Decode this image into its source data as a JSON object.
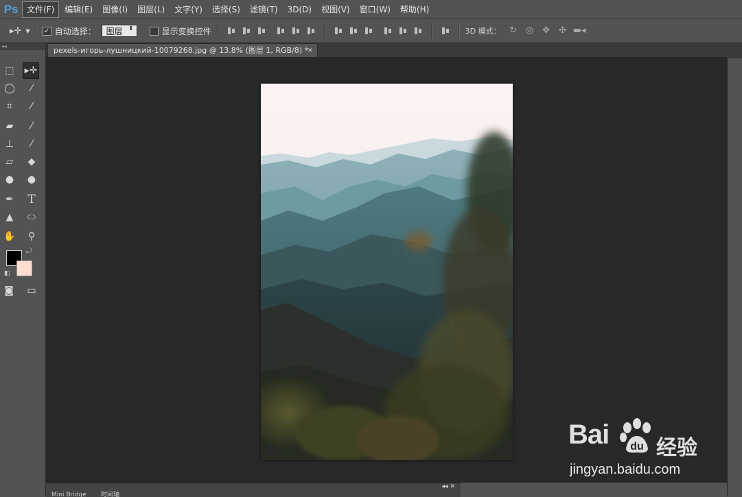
{
  "app": {
    "logo": "Ps"
  },
  "menu": [
    {
      "label": "文件(F)",
      "active": true
    },
    {
      "label": "编辑(E)"
    },
    {
      "label": "图像(I)"
    },
    {
      "label": "图层(L)"
    },
    {
      "label": "文字(Y)"
    },
    {
      "label": "选择(S)"
    },
    {
      "label": "滤镜(T)"
    },
    {
      "label": "3D(D)"
    },
    {
      "label": "视图(V)"
    },
    {
      "label": "窗口(W)"
    },
    {
      "label": "帮助(H)"
    }
  ],
  "options": {
    "move_tool_icon": "move-arrow-icon",
    "auto_select_label": "自动选择：",
    "auto_select_checked": "✓",
    "auto_select_value": "图层",
    "show_transform_label": "显示变换控件",
    "mode3d_label": "3D 模式："
  },
  "document": {
    "tab_title": "pexels-игорь-лушницкий-10079268.jpg @ 13.8% (图层 1, RGB/8) *",
    "close": "×"
  },
  "colors": {
    "foreground": "#000000",
    "background": "#fcddd0"
  },
  "bottom_panel": {
    "tabs": [
      "Mini Bridge",
      "时间轴"
    ],
    "controls": "◂◂  ✕"
  },
  "watermark": {
    "brand": "Bai",
    "product": "经验",
    "url": "jingyan.baidu.com"
  }
}
